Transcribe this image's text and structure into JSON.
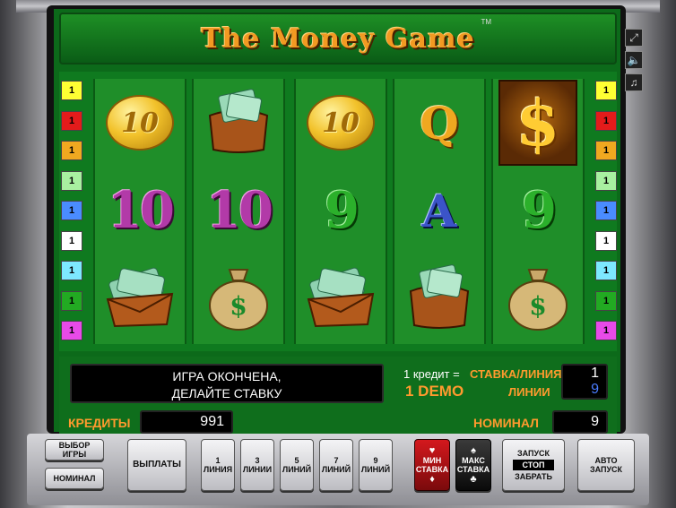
{
  "title": "The Money Game",
  "trademark": "TM",
  "reels": [
    [
      "coin-10-icon",
      "purple-10-icon",
      "money-bag-envelope-icon"
    ],
    [
      "money-bundle-icon",
      "purple-10-icon",
      "dollar-sack-icon"
    ],
    [
      "coin-10-icon",
      "green-9-icon",
      "money-bag-envelope-icon"
    ],
    [
      "letter-q-icon",
      "letter-a-icon",
      "money-bundle-icon"
    ],
    [
      "dollar-sign-icon",
      "green-9-icon",
      "dollar-sack-icon"
    ]
  ],
  "symbols": {
    "coin_text": "10",
    "purple_ten": "10",
    "green_nine": "9",
    "letter_q": "Q",
    "letter_a": "A",
    "dollar": "$"
  },
  "line_indicators": {
    "label": "1",
    "colors": [
      "#ffff33",
      "#e31b1b",
      "#f0a820",
      "#a8f0a0",
      "#4a8cff",
      "#ffffff",
      "#7de8ff",
      "#22aa22",
      "#e84ae8"
    ]
  },
  "line_indicators_right": {
    "colors": [
      "#ffff33",
      "#e31b1b",
      "#f0a820",
      "#a8f0a0",
      "#4a8cff",
      "#ffffff",
      "#7de8ff",
      "#22aa22",
      "#e84ae8"
    ]
  },
  "message": {
    "line1": "ИГРА ОКОНЧЕНА,",
    "line2": "ДЕЛАЙТЕ СТАВКУ"
  },
  "bet_info": {
    "credit_eq": "1 кредит =",
    "bet_per_line_label": "СТАВКА/ЛИНИЯ",
    "bet_per_line_value": "1",
    "demo": "1 DEMO",
    "lines_label": "ЛИНИИ",
    "lines_value": "9"
  },
  "credits": {
    "label": "КРЕДИТЫ",
    "value": "991"
  },
  "denomination": {
    "label": "НОМИНАЛ",
    "value": "9"
  },
  "buttons": {
    "select_game_1": "ВЫБОР",
    "select_game_2": "ИГРЫ",
    "nominal": "НОМИНАЛ",
    "payouts": "ВЫПЛАТЫ",
    "lines": [
      {
        "num": "1",
        "label": "ЛИНИЯ"
      },
      {
        "num": "3",
        "label": "ЛИНИИ"
      },
      {
        "num": "5",
        "label": "ЛИНИЙ"
      },
      {
        "num": "7",
        "label": "ЛИНИЙ"
      },
      {
        "num": "9",
        "label": "ЛИНИЙ"
      }
    ],
    "min_bet_1": "МИН",
    "min_bet_2": "СТАВКА",
    "max_bet_1": "МАКС",
    "max_bet_2": "СТАВКА",
    "start": "ЗАПУСК",
    "stop": "СТОП",
    "take": "ЗАБРАТЬ",
    "auto_1": "АВТО",
    "auto_2": "ЗАПУСК"
  },
  "side_controls": [
    "fullscreen-icon",
    "sound-icon",
    "music-icon"
  ]
}
